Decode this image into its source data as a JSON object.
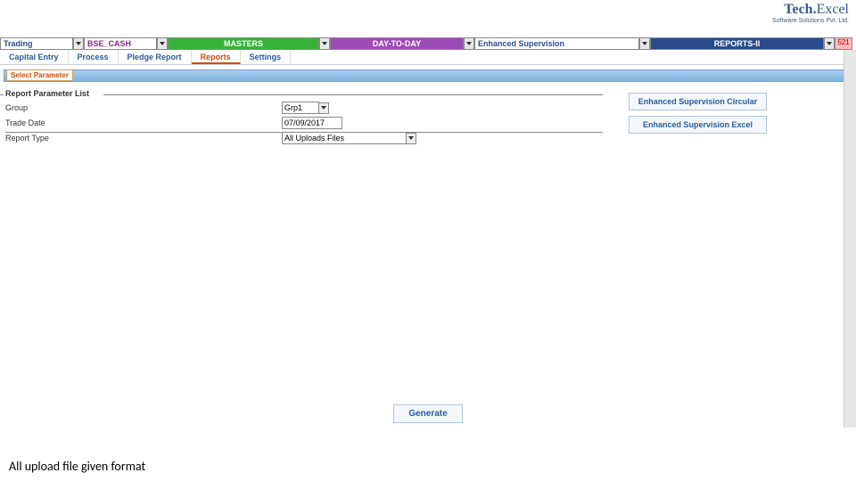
{
  "brand": {
    "name_a": "Tech.",
    "name_b": "Excel",
    "tag": "Software Solutions Pvt. Ltd."
  },
  "menubar": {
    "trading": "Trading",
    "bse": "BSE_CASH",
    "masters": "MASTERS",
    "day": "DAY-TO-DAY",
    "enhanced": "Enhanced Supervision",
    "reports": "REPORTS-II",
    "end": "521"
  },
  "submenu": {
    "items": [
      "Capital Entry",
      "Process",
      "Pledge Report",
      "Reports",
      "Settings"
    ],
    "active_index": 3
  },
  "param_tab": "Select Parameter",
  "fieldset_title": "Report Parameter List",
  "params": {
    "group_label": "Group",
    "group_value": "Grp1",
    "trade_date_label": "Trade Date",
    "trade_date_value": "07/09/2017",
    "report_type_label": "Report Type",
    "report_type_value": "All Uploads Files"
  },
  "side": {
    "circular": "Enhanced Supervision Circular",
    "excel": "Enhanced Supervision Excel"
  },
  "generate": "Generate",
  "footer": "All upload file given format"
}
